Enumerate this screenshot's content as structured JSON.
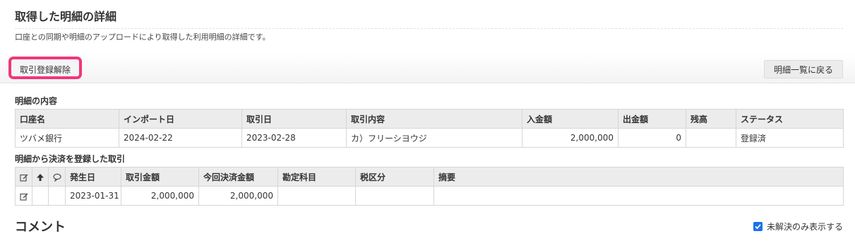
{
  "page": {
    "title": "取得した明細の詳細",
    "description": "口座との同期や明細のアップロードにより取得した利用明細の詳細です。"
  },
  "toolbar": {
    "unlink_label": "取引登録解除",
    "back_label": "明細一覧に戻る"
  },
  "detail": {
    "section_label": "明細の内容",
    "headers": [
      "口座名",
      "インポート日",
      "取引日",
      "取引内容",
      "入金額",
      "出金額",
      "残高",
      "ステータス"
    ],
    "row": {
      "account": "ツバメ銀行",
      "import_date": "2024-02-22",
      "transaction_date": "2023-02-28",
      "content": "カ）フリーシヨウジ",
      "deposit": "2,000,000",
      "withdrawal": "0",
      "balance": "",
      "status": "登録済"
    }
  },
  "linked": {
    "section_label": "明細から決済を登録した取引",
    "headers": [
      "発生日",
      "取引金額",
      "今回決済金額",
      "勘定科目",
      "税区分",
      "摘要"
    ],
    "rows": [
      {
        "date": "2023-01-31",
        "amount": "2,000,000",
        "settled_amount": "2,000,000",
        "account_item": "",
        "tax_category": "",
        "memo": ""
      }
    ]
  },
  "comments": {
    "title": "コメント",
    "unresolved_only_label": "未解決のみ表示する",
    "unresolved_only_checked": true
  },
  "colors": {
    "highlight_border": "#f0367a",
    "checkbox": "#1a73e8",
    "header_bg": "#ececec"
  }
}
